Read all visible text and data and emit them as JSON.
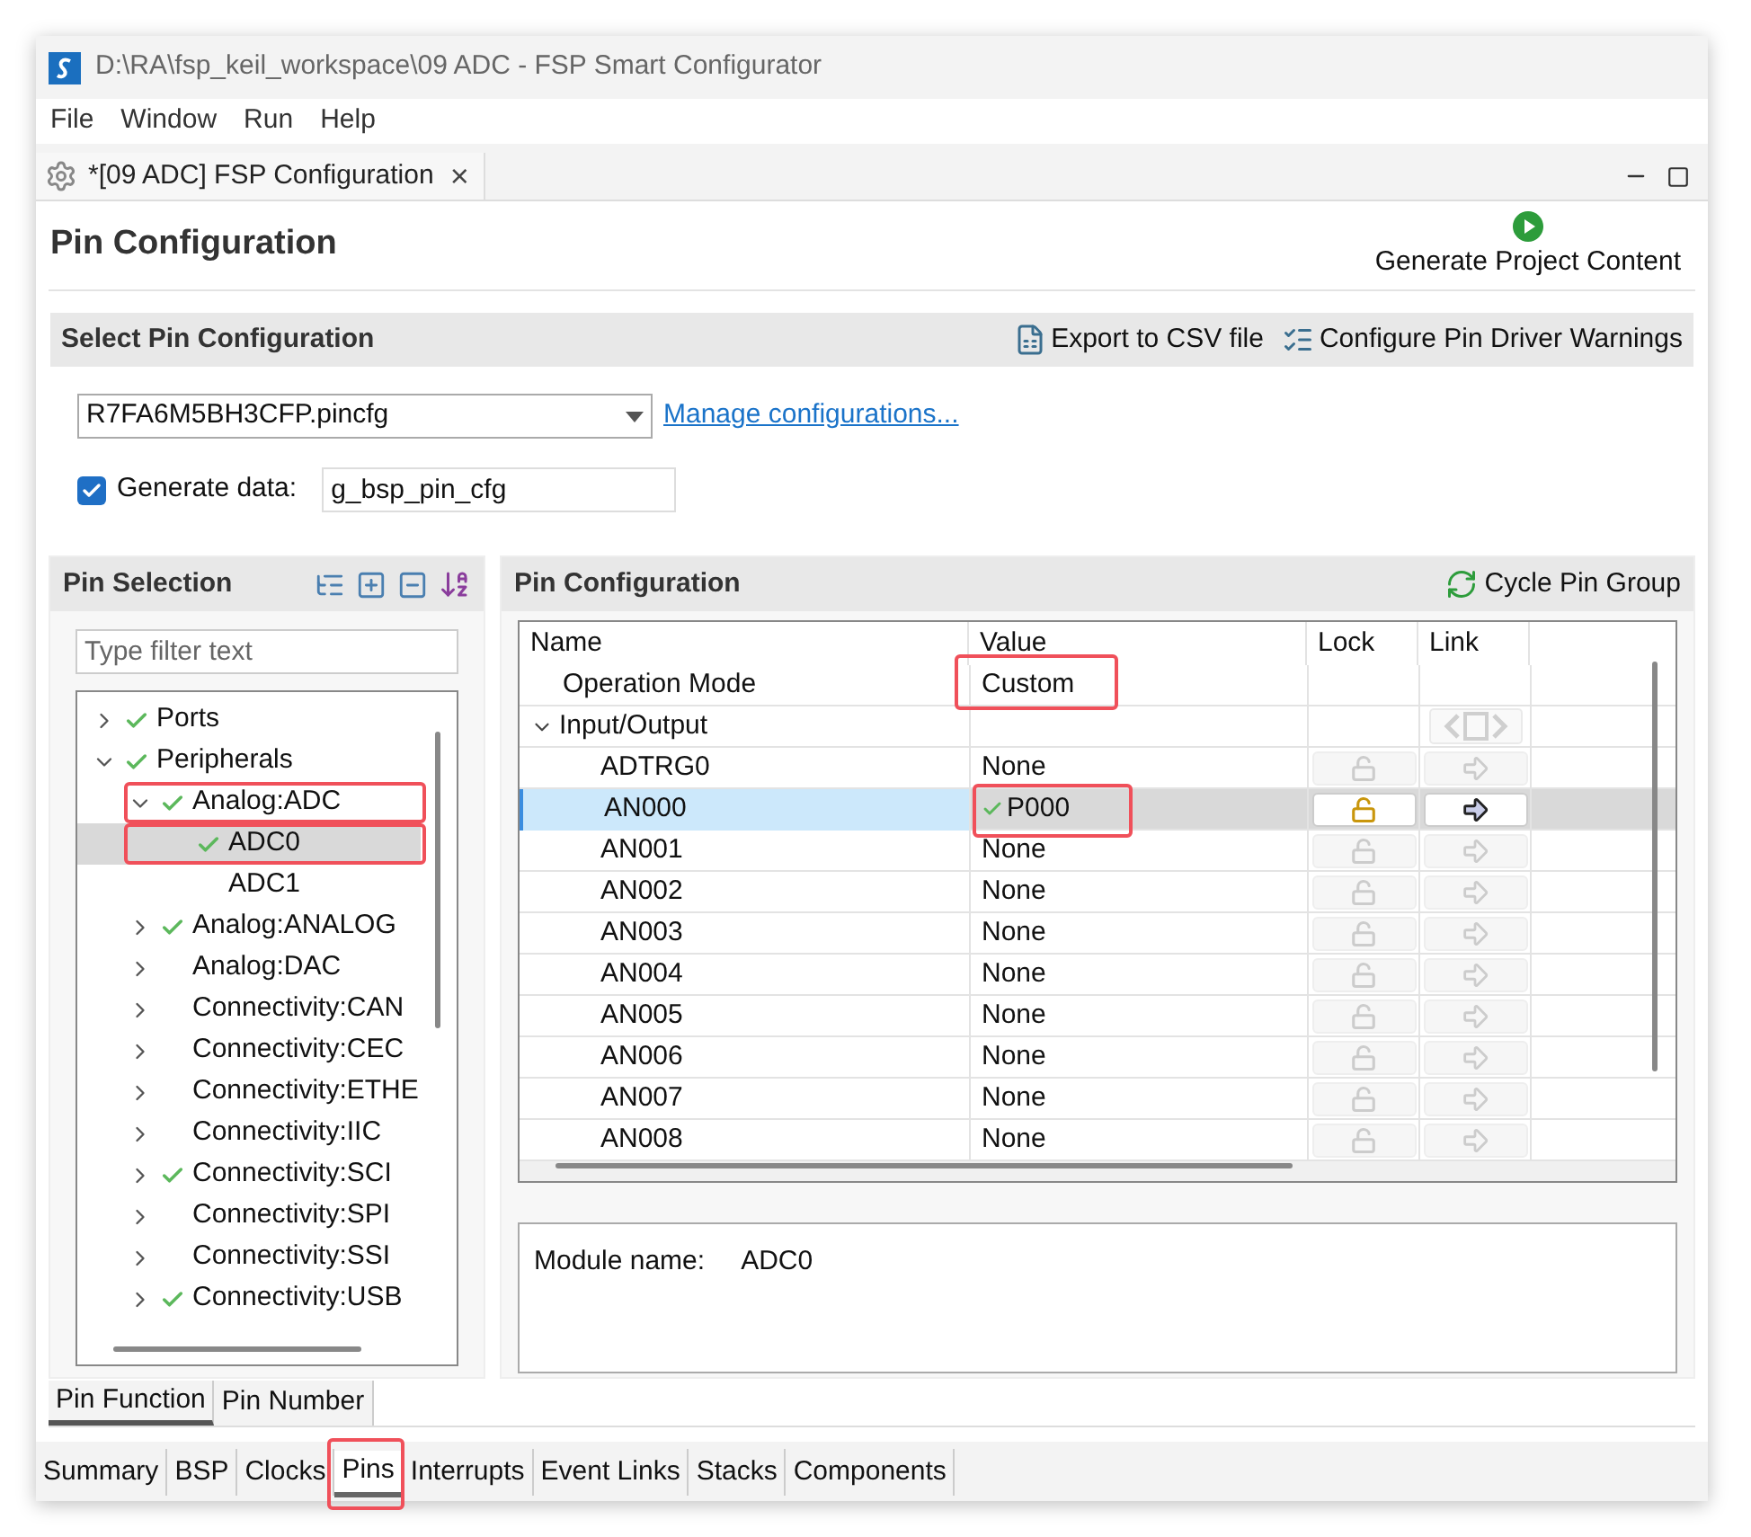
{
  "window": {
    "title": "D:\\RA\\fsp_keil_workspace\\09 ADC - FSP Smart Configurator"
  },
  "menu": [
    "File",
    "Window",
    "Run",
    "Help"
  ],
  "editor_tab": {
    "title": "*[09 ADC] FSP Configuration",
    "close": "×"
  },
  "header": {
    "title": "Pin Configuration",
    "generate_button": "Generate Project Content"
  },
  "select_section": {
    "title": "Select Pin Configuration",
    "actions": [
      "Export to CSV file",
      "Configure Pin Driver Warnings"
    ],
    "config_select": "R7FA6M5BH3CFP.pincfg",
    "manage_link": "Manage configurations...",
    "generate_data": {
      "label": "Generate data:",
      "checked": true,
      "value": "g_bsp_pin_cfg"
    }
  },
  "pin_selection": {
    "title": "Pin Selection",
    "filter_placeholder": "Type filter text",
    "tree": [
      {
        "label": "Ports",
        "checked": true,
        "expanded": false,
        "selected": false,
        "highlighted": false
      },
      {
        "label": "Peripherals",
        "checked": true,
        "expanded": true,
        "selected": false,
        "highlighted": false,
        "children": [
          {
            "label": "Analog:ADC",
            "checked": true,
            "expanded": true,
            "selected": false,
            "highlighted": true,
            "children": [
              {
                "label": "ADC0",
                "checked": true,
                "selected": true,
                "highlighted": true
              },
              {
                "label": "ADC1",
                "checked": false,
                "selected": false,
                "highlighted": false
              }
            ]
          },
          {
            "label": "Analog:ANALOG",
            "checked": true,
            "expanded": false,
            "selected": false,
            "highlighted": false
          },
          {
            "label": "Analog:DAC",
            "checked": false,
            "expanded": false,
            "selected": false,
            "highlighted": false
          },
          {
            "label": "Connectivity:CAN",
            "checked": false,
            "expanded": false,
            "selected": false,
            "highlighted": false
          },
          {
            "label": "Connectivity:CEC",
            "checked": false,
            "expanded": false,
            "selected": false,
            "highlighted": false
          },
          {
            "label": "Connectivity:ETHE",
            "checked": false,
            "expanded": false,
            "selected": false,
            "highlighted": false
          },
          {
            "label": "Connectivity:IIC",
            "checked": false,
            "expanded": false,
            "selected": false,
            "highlighted": false
          },
          {
            "label": "Connectivity:SCI",
            "checked": true,
            "expanded": false,
            "selected": false,
            "highlighted": false
          },
          {
            "label": "Connectivity:SPI",
            "checked": false,
            "expanded": false,
            "selected": false,
            "highlighted": false
          },
          {
            "label": "Connectivity:SSI",
            "checked": false,
            "expanded": false,
            "selected": false,
            "highlighted": false
          },
          {
            "label": "Connectivity:USB",
            "checked": true,
            "expanded": false,
            "selected": false,
            "highlighted": false
          }
        ]
      }
    ]
  },
  "pin_configuration": {
    "title": "Pin Configuration",
    "cycle_button": "Cycle Pin Group",
    "columns": [
      "Name",
      "Value",
      "Lock",
      "Link"
    ],
    "rows": [
      {
        "kind": "setting",
        "name": "Operation Mode",
        "value": "Custom",
        "highlighted": true
      },
      {
        "kind": "group",
        "name": "Input/Output",
        "expanded": true
      },
      {
        "kind": "pin",
        "name": "ADTRG0",
        "value": "None",
        "checked": false,
        "enabled": false,
        "selected": false,
        "highlighted": false
      },
      {
        "kind": "pin",
        "name": "AN000",
        "value": "P000",
        "checked": true,
        "enabled": true,
        "selected": true,
        "highlighted": true
      },
      {
        "kind": "pin",
        "name": "AN001",
        "value": "None",
        "checked": false,
        "enabled": false,
        "selected": false,
        "highlighted": false
      },
      {
        "kind": "pin",
        "name": "AN002",
        "value": "None",
        "checked": false,
        "enabled": false,
        "selected": false,
        "highlighted": false
      },
      {
        "kind": "pin",
        "name": "AN003",
        "value": "None",
        "checked": false,
        "enabled": false,
        "selected": false,
        "highlighted": false
      },
      {
        "kind": "pin",
        "name": "AN004",
        "value": "None",
        "checked": false,
        "enabled": false,
        "selected": false,
        "highlighted": false
      },
      {
        "kind": "pin",
        "name": "AN005",
        "value": "None",
        "checked": false,
        "enabled": false,
        "selected": false,
        "highlighted": false
      },
      {
        "kind": "pin",
        "name": "AN006",
        "value": "None",
        "checked": false,
        "enabled": false,
        "selected": false,
        "highlighted": false
      },
      {
        "kind": "pin",
        "name": "AN007",
        "value": "None",
        "checked": false,
        "enabled": false,
        "selected": false,
        "highlighted": false
      },
      {
        "kind": "pin",
        "name": "AN008",
        "value": "None",
        "checked": false,
        "enabled": false,
        "selected": false,
        "highlighted": false
      }
    ],
    "module": {
      "label": "Module name:",
      "value": "ADC0"
    }
  },
  "view_tabs": [
    {
      "label": "Pin Function",
      "selected": true
    },
    {
      "label": "Pin Number",
      "selected": false
    }
  ],
  "page_tabs": [
    {
      "label": "Summary",
      "selected": false,
      "highlighted": false
    },
    {
      "label": "BSP",
      "selected": false,
      "highlighted": false
    },
    {
      "label": "Clocks",
      "selected": false,
      "highlighted": false
    },
    {
      "label": "Pins",
      "selected": true,
      "highlighted": true
    },
    {
      "label": "Interrupts",
      "selected": false,
      "highlighted": false
    },
    {
      "label": "Event Links",
      "selected": false,
      "highlighted": false
    },
    {
      "label": "Stacks",
      "selected": false,
      "highlighted": false
    },
    {
      "label": "Components",
      "selected": false,
      "highlighted": false
    }
  ]
}
